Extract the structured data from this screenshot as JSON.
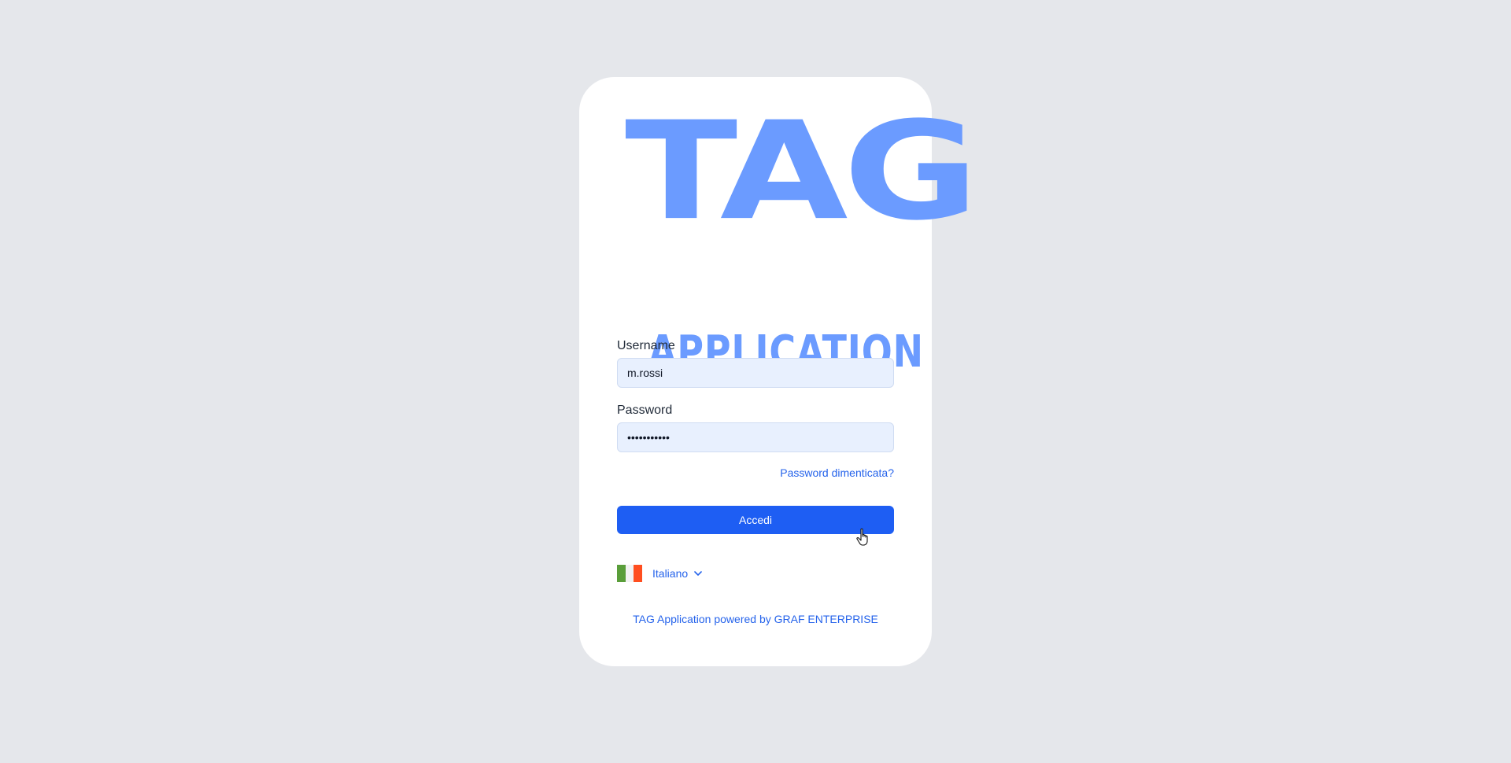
{
  "logo": {
    "line1": "TAG",
    "line2": "APPLICATION"
  },
  "form": {
    "username_label": "Username",
    "username_value": "m.rossi",
    "password_label": "Password",
    "password_value": "hunter2pass",
    "forgot_link": "Password dimenticata?",
    "submit_label": "Accedi"
  },
  "language": {
    "selected": "Italiano",
    "flag_icon": "italy-flag-icon",
    "flag_colors": [
      "#5a9e3a",
      "#ffffff",
      "#ff4e1f"
    ]
  },
  "footer": {
    "text": "TAG Application powered by GRAF ENTERPRISE"
  },
  "colors": {
    "accent": "#1e5ef3",
    "logo": "#6b9bff",
    "link": "#2563eb",
    "background": "#e5e7eb"
  }
}
